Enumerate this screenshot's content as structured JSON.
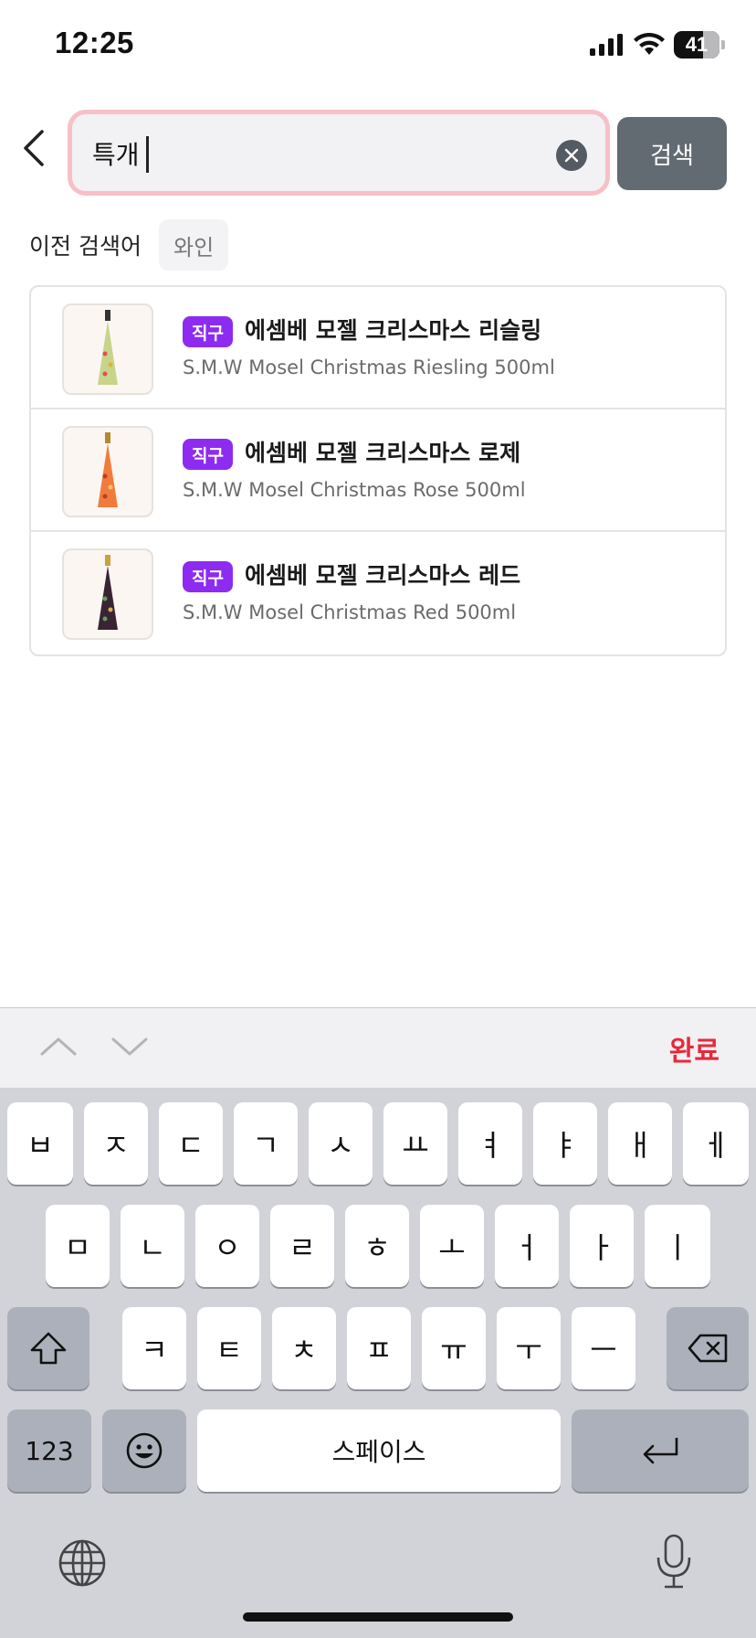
{
  "status_bar": {
    "time": "12:25",
    "battery": "41"
  },
  "search": {
    "value": "특개",
    "button_label": "검색"
  },
  "recent": {
    "label": "이전 검색어",
    "chips": [
      "와인"
    ]
  },
  "results": [
    {
      "badge": "직구",
      "title": "에셈베 모젤 크리스마스 리슬링",
      "subtitle": "S.M.W Mosel Christmas Riesling 500ml",
      "bottle_color": "#c8d48a"
    },
    {
      "badge": "직구",
      "title": "에셈베 모젤 크리스마스 로제",
      "subtitle": "S.M.W Mosel Christmas Rose 500ml",
      "bottle_color": "#f07c3c"
    },
    {
      "badge": "직구",
      "title": "에셈베 모젤 크리스마스 레드",
      "subtitle": "S.M.W Mosel Christmas Red 500ml",
      "bottle_color": "#3a2434"
    }
  ],
  "keyboard_toolbar": {
    "done_label": "완료"
  },
  "keyboard": {
    "row1": [
      "ㅂ",
      "ㅈ",
      "ㄷ",
      "ㄱ",
      "ㅅ",
      "ㅛ",
      "ㅕ",
      "ㅑ",
      "ㅐ",
      "ㅔ"
    ],
    "row2": [
      "ㅁ",
      "ㄴ",
      "ㅇ",
      "ㄹ",
      "ㅎ",
      "ㅗ",
      "ㅓ",
      "ㅏ",
      "ㅣ"
    ],
    "row3": [
      "ㅋ",
      "ㅌ",
      "ㅊ",
      "ㅍ",
      "ㅠ",
      "ㅜ",
      "ㅡ"
    ],
    "numbers_label": "123",
    "space_label": "스페이스"
  },
  "colors": {
    "accent": "#e8283a",
    "badge": "#8d2cf0",
    "search_border": "#f7c0c8",
    "search_button": "#626a72"
  }
}
